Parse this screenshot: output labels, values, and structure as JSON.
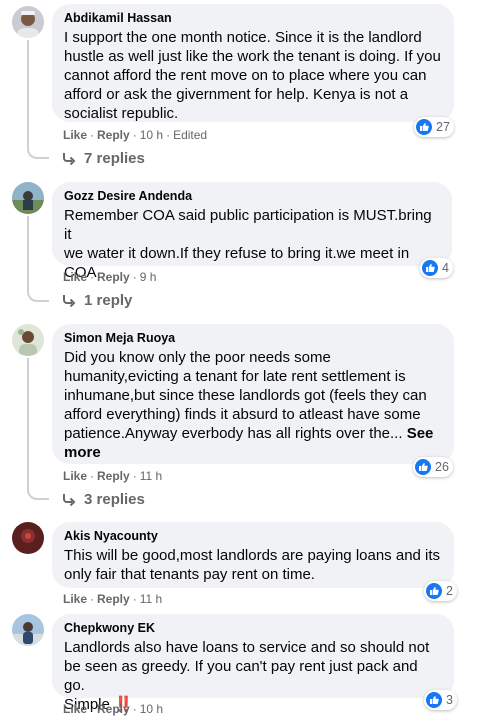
{
  "comments": [
    {
      "author": "Abdikamil Hassan",
      "text": "I support the one month notice. Since it is the landlord\nhustle as well just like the work the tenant is doing. If you\ncannot afford the rent move on to place where you can\nafford or ask the givernment for help. Kenya is not a\nsocialist republic.",
      "like_label": "Like",
      "reply_label": "Reply",
      "time": "10 h",
      "edited": "Edited",
      "reaction_count": "27",
      "replies_label": "7 replies"
    },
    {
      "author": "Gozz Desire Andenda",
      "text": "Remember COA said public participation is MUST.bring it\nwe water it down.If they refuse to bring it.we meet in\nCOA",
      "like_label": "Like",
      "reply_label": "Reply",
      "time": "9 h",
      "reaction_count": "4",
      "replies_label": "1 reply"
    },
    {
      "author": "Simon Meja Ruoya",
      "text": "Did you know only the poor needs some\nhumanity,evicting a tenant for late rent settlement is\ninhumane,but since these landlords got (feels they can\nafford everything) finds it absurd to atleast have some\npatience.Anyway everbody has all rights over the...",
      "see_more": "See\nmore",
      "like_label": "Like",
      "reply_label": "Reply",
      "time": "11 h",
      "reaction_count": "26",
      "replies_label": "3 replies"
    },
    {
      "author": "Akis Nyacounty",
      "text": "This will be good,most landlords are paying loans and its\nonly fair that tenants pay rent on time.",
      "like_label": "Like",
      "reply_label": "Reply",
      "time": "11 h",
      "reaction_count": "2"
    },
    {
      "author": "Chepkwony EK",
      "text": "Landlords also have loans to service and so should not\nbe seen as greedy. If you can't pay rent just pack and go.\nSimple",
      "emoji": "‼️",
      "like_label": "Like",
      "reply_label": "Reply",
      "time": "10 h",
      "reaction_count": "3"
    }
  ],
  "colors": {
    "bubble": "#f0f2f5",
    "like_blue": "#1877f2",
    "meta_gray": "#65676b"
  },
  "icons": {
    "reaction": "like-thumb-icon",
    "reply": "reply-arrow-icon"
  }
}
